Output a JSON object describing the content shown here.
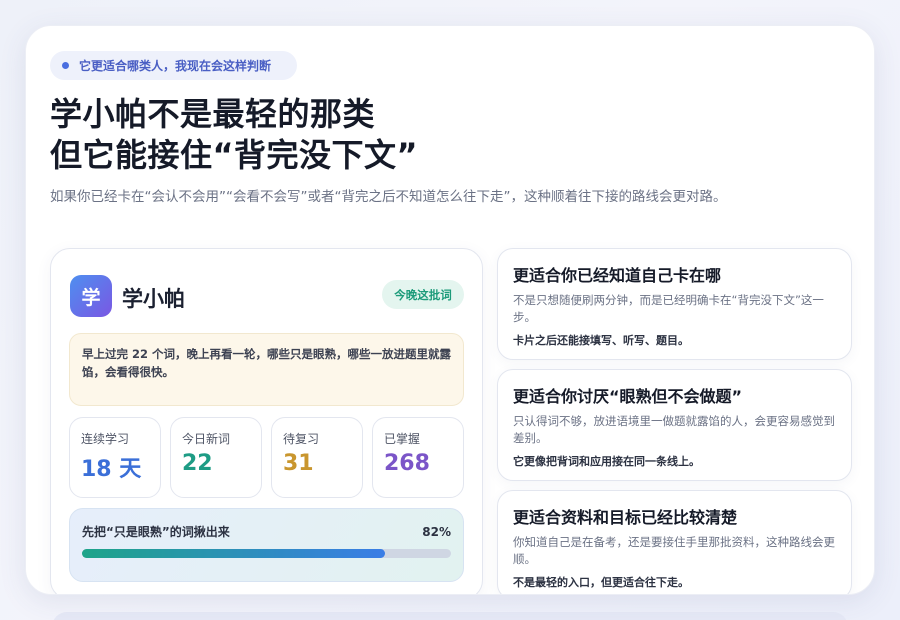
{
  "tag": {
    "text": "它更适合哪类人，我现在会这样判断"
  },
  "headline": {
    "line1": "学小帕不是最轻的那类",
    "line2": "但它能接住“背完没下文”"
  },
  "subline": "如果你已经卡在“会认不会用”“会看不会写”或者“背完之后不知道怎么往下走”，这种顺着往下接的路线会更对路。",
  "app": {
    "logo_char": "学",
    "name": "学小帕",
    "badge": "今晚这批词",
    "note": "早上过完 22 个词，晚上再看一轮，哪些只是眼熟，哪些一放进题里就露馅，会看得很快。",
    "stats": [
      {
        "label": "连续学习",
        "value": "18 天",
        "color": "#3b6fd8"
      },
      {
        "label": "今日新词",
        "value": "22",
        "color": "#1e9c85"
      },
      {
        "label": "待复习",
        "value": "31",
        "color": "#c9962e"
      },
      {
        "label": "已掌握",
        "value": "268",
        "color": "#7b55c8"
      }
    ],
    "progress": {
      "label": "先把“只是眼熟”的词揪出来",
      "percent_text": "82%",
      "value": 0.82
    }
  },
  "fit_cards": [
    {
      "title": "更适合你已经知道自己卡在哪",
      "desc": "不是只想随便刷两分钟，而是已经明确卡在“背完没下文”这一步。",
      "foot": "卡片之后还能接填写、听写、题目。"
    },
    {
      "title": "更适合你讨厌“眼熟但不会做题”",
      "desc": "只认得词不够，放进语境里一做题就露馅的人，会更容易感觉到差别。",
      "foot": "它更像把背词和应用接在同一条线上。"
    },
    {
      "title": "更适合资料和目标已经比较清楚",
      "desc": "你知道自己是在备考，还是要接住手里那批资料，这种路线会更顺。",
      "foot": "不是最轻的入口，但更适合往下走。"
    }
  ]
}
